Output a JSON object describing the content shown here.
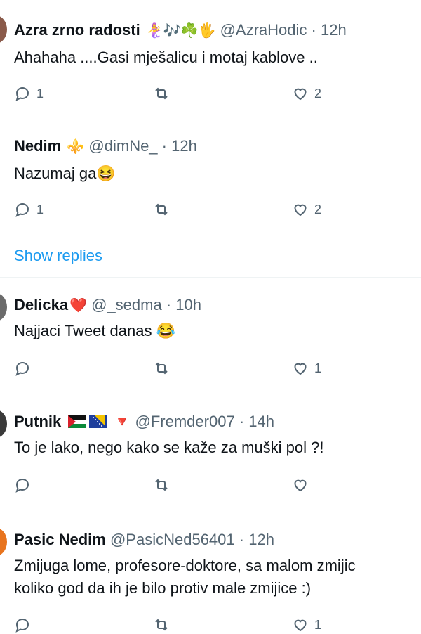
{
  "tweets": [
    {
      "name": "Azra zrno radosti",
      "emojis": "🧜‍♀️🎶☘️🖐",
      "handle": "@AzraHodic",
      "time": "12h",
      "text": [
        "Ahahaha ....Gasi mješalicu i motaj kablove .."
      ],
      "replies": "1",
      "retweets": "",
      "likes": "2",
      "avatar_color": "#8a5a4a"
    },
    {
      "name": "Nedim",
      "emojis": "⚜️",
      "handle": "@dimNe_",
      "time": "12h",
      "text": [
        "Nazumaj ga😆"
      ],
      "replies": "1",
      "retweets": "",
      "likes": "2"
    },
    {
      "name": "Delicka",
      "emojis": "❤️",
      "handle": "@_sedma",
      "time": "10h",
      "text": [
        "Najjaci Tweet danas 😂"
      ],
      "replies": "",
      "retweets": "",
      "likes": "1",
      "avatar_color": "#6b6b6b"
    },
    {
      "name": "Putnik",
      "emojis": "🔻",
      "handle": "@Fremder007",
      "time": "14h",
      "text": [
        "To je lako, nego kako se kaže za muški pol ?!"
      ],
      "replies": "",
      "retweets": "",
      "likes": "",
      "avatar_color": "#3a3a3a"
    },
    {
      "name": "Pasic Nedim",
      "emojis": "",
      "handle": "@PasicNed56401",
      "time": "12h",
      "text": [
        "Zmijuga lome, profesore-doktore, sa malom zmijic",
        "koliko god da ih je bilo protiv male zmijice :)"
      ],
      "replies": "",
      "retweets": "",
      "likes": "1",
      "avatar_color": "#e8741e"
    }
  ],
  "show_replies": "Show replies",
  "separator": "·",
  "colors": {
    "accent": "#1d9bf0",
    "muted": "#536471",
    "text": "#0f1419",
    "divider": "#eff3f4"
  }
}
